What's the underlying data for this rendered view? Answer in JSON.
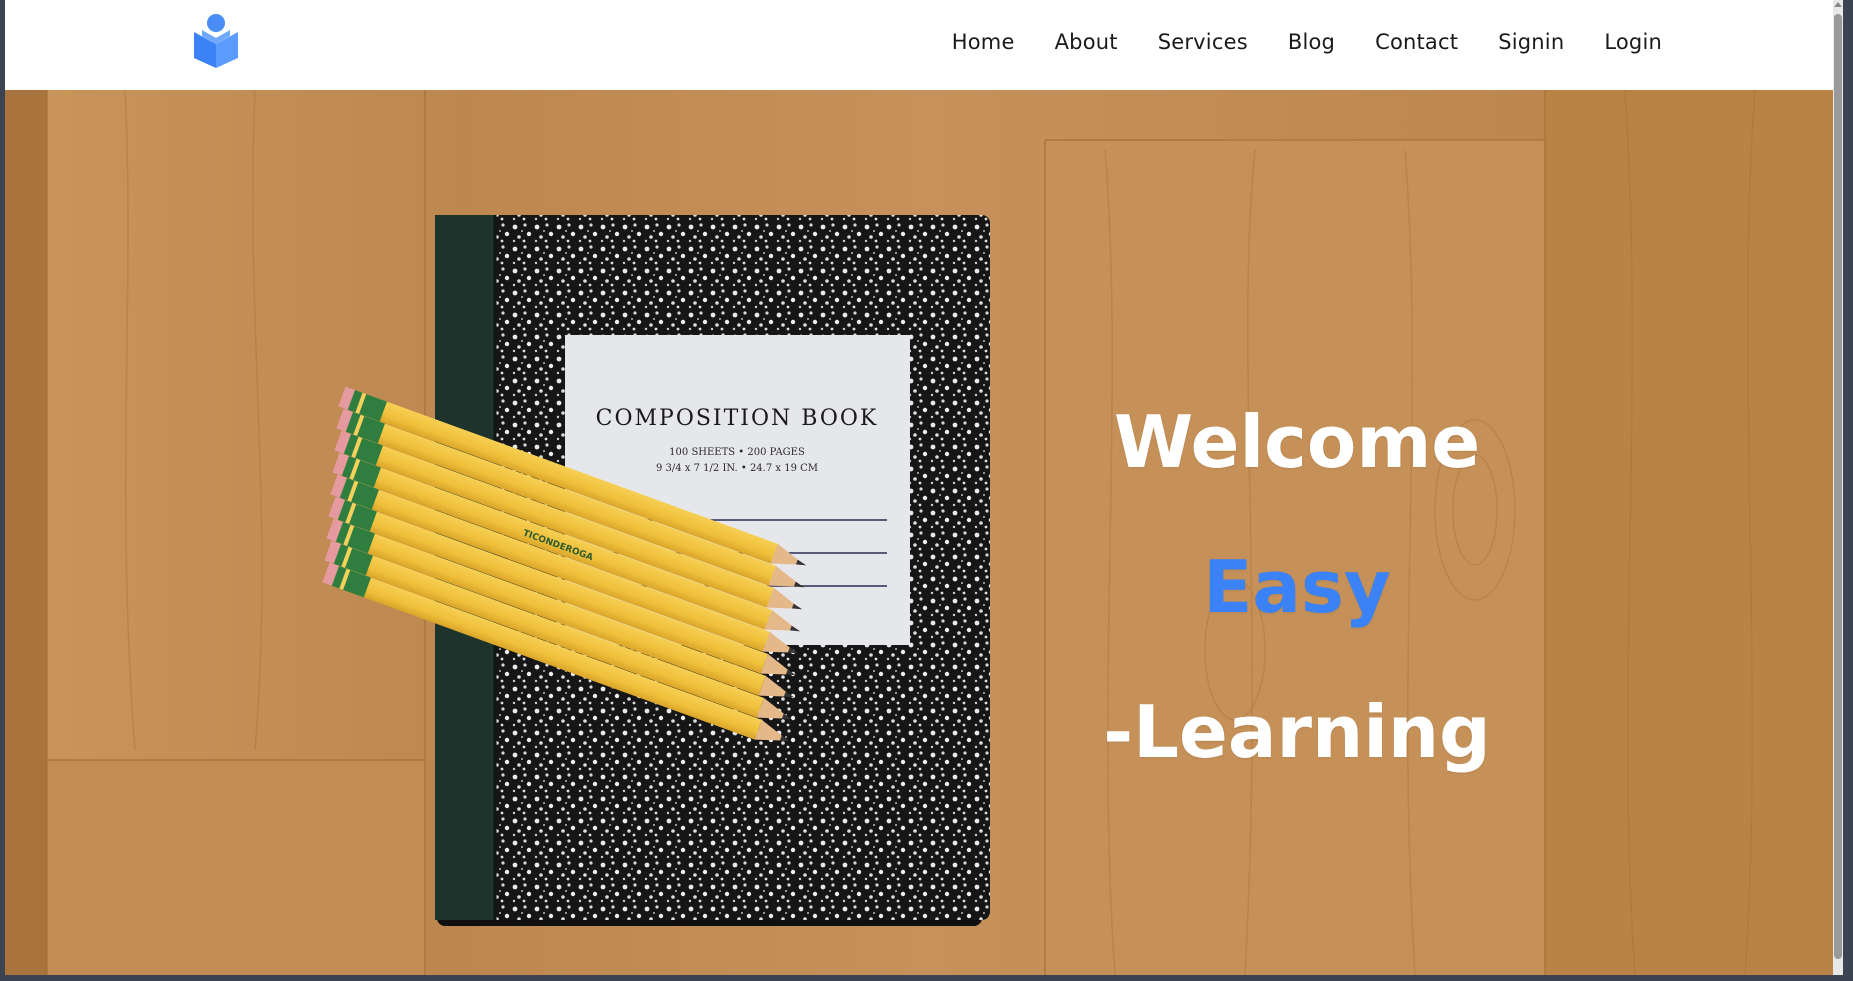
{
  "nav": {
    "logo_icon": "book-reader-icon",
    "links": [
      {
        "label": "Home"
      },
      {
        "label": "About"
      },
      {
        "label": "Services"
      },
      {
        "label": "Blog"
      },
      {
        "label": "Contact"
      },
      {
        "label": "Signin"
      },
      {
        "label": "Login"
      }
    ]
  },
  "hero": {
    "line1": "Welcome",
    "line2": "Easy",
    "line3": "-Learning",
    "image": {
      "book_title": "COMPOSITION BOOK",
      "book_subtitle": "100 SHEETS • 200 PAGES",
      "book_size": "9 3/4 x 7 1/2 IN. • 24.7 x 19 CM",
      "pencil_brand": "TICONDEROGA"
    }
  },
  "colors": {
    "accent": "#3b82f6",
    "nav_background": "#ffffff",
    "wood": "#c08a4e",
    "hero_text": "#ffffff"
  }
}
